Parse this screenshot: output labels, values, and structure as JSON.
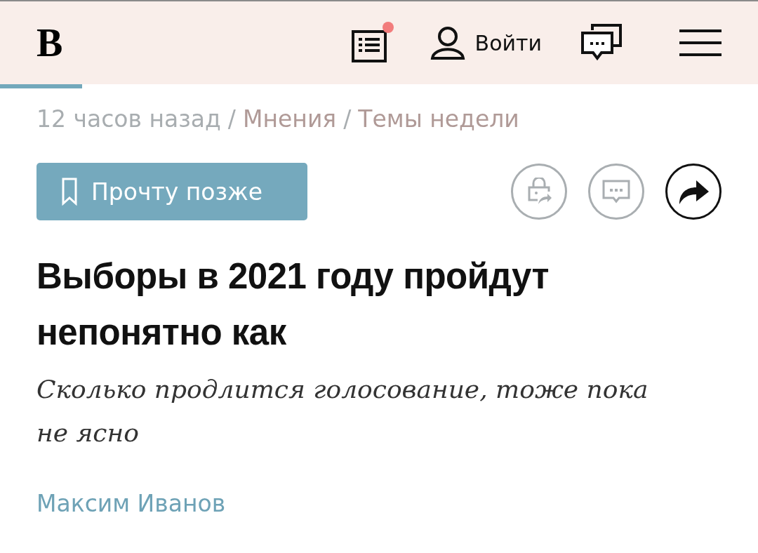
{
  "header": {
    "logo": "B",
    "feed_notification": true,
    "login": "Войти"
  },
  "reading_progress": {
    "level": 0.108
  },
  "breadcrumb": [
    {
      "kind": "time",
      "label": "12 часов назад"
    },
    {
      "kind": "separator",
      "label": "/"
    },
    {
      "kind": "link",
      "label": "Мнения"
    },
    {
      "kind": "separator",
      "label": "/"
    },
    {
      "kind": "link",
      "label": "Темы недели"
    }
  ],
  "save_button": {
    "label": "Прочту позже"
  },
  "actions": [
    {
      "kind": "gift",
      "enabled": false
    },
    {
      "kind": "comments",
      "enabled": false
    },
    {
      "kind": "share",
      "enabled": true
    }
  ],
  "headline": "Выборы в 2021 году пройдут непонятно как",
  "subtitle": "Сколько продлится голосование, тоже пока не ясно",
  "author": "Максим Иванов"
}
